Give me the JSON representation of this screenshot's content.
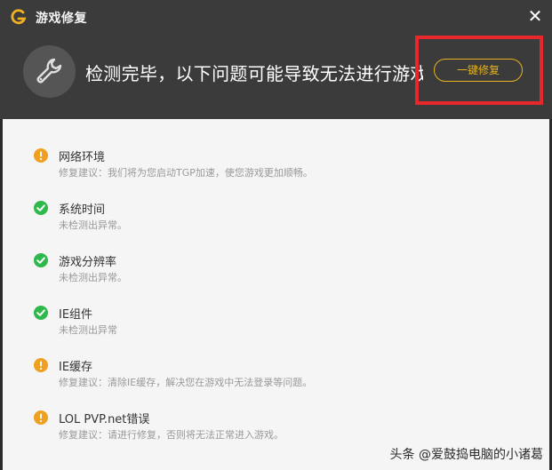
{
  "window": {
    "title": "游戏修复",
    "close_label": "✕"
  },
  "header": {
    "headline": "检测完毕，以下问题可能导致无法进行游戏",
    "fix_button": "一键修复"
  },
  "issues": [
    {
      "status": "warning",
      "icon": "exclamation-icon",
      "title": "网络环境",
      "desc": "修复建议：我们将为您启动TGP加速，使您游戏更加顺畅。"
    },
    {
      "status": "ok",
      "icon": "check-icon",
      "title": "系统时间",
      "desc": "未检测出异常。"
    },
    {
      "status": "ok",
      "icon": "check-icon",
      "title": "游戏分辨率",
      "desc": "未检测出异常。"
    },
    {
      "status": "ok",
      "icon": "check-icon",
      "title": "IE组件",
      "desc": "未检测出异常"
    },
    {
      "status": "warning",
      "icon": "exclamation-icon",
      "title": "IE缓存",
      "desc": "修复建议：清除IE缓存，解决您在游戏中无法登录等问题。"
    },
    {
      "status": "warning",
      "icon": "exclamation-icon",
      "title": "LOL PVP.net错误",
      "desc": "修复建议：请进行修复，否则将无法正常进入游戏。"
    }
  ],
  "watermark": "头条 @爱鼓捣电脑的小诸葛",
  "colors": {
    "header_bg": "#3b3b3b",
    "accent": "#e6b21e",
    "warning": "#f0a020",
    "ok": "#2fb84b",
    "highlight": "#e8272a"
  }
}
